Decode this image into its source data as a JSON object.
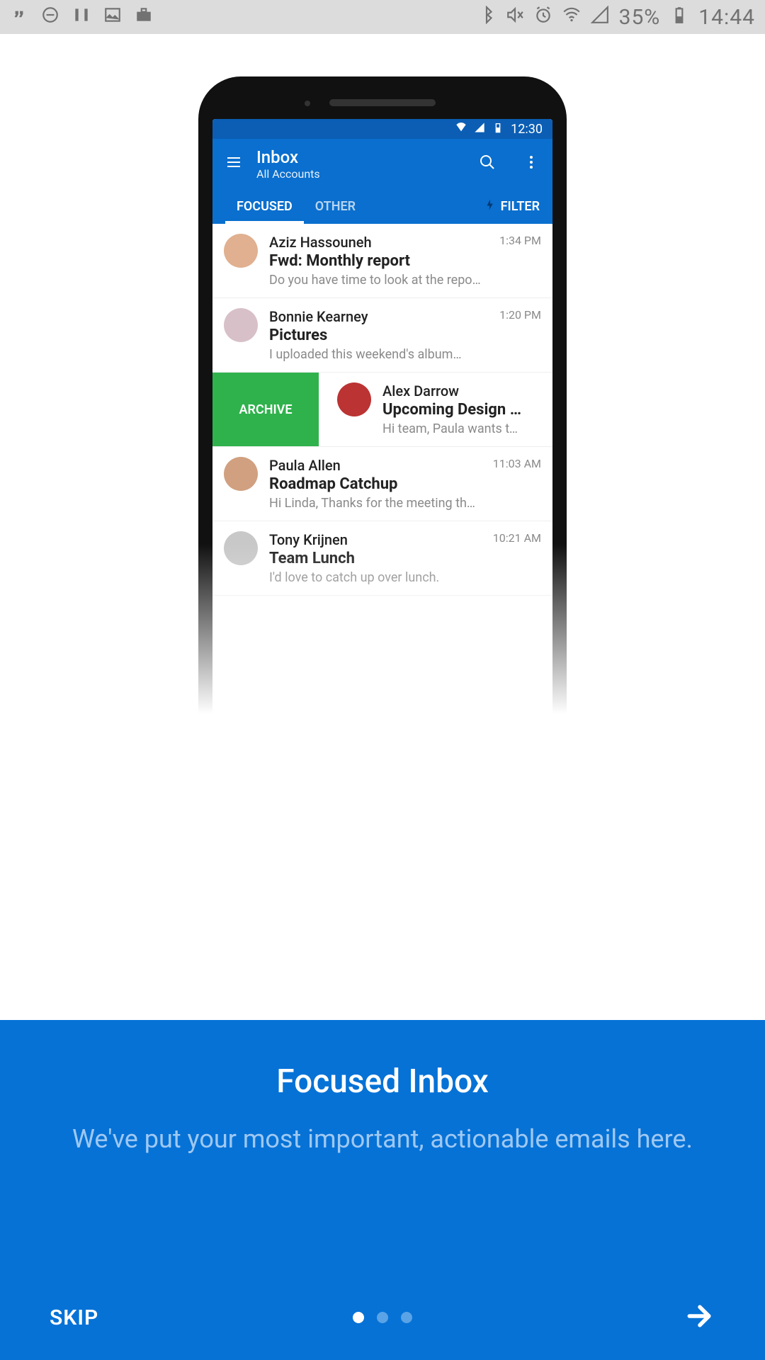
{
  "host_status": {
    "battery_pct": "35%",
    "clock": "14:44"
  },
  "mock": {
    "status_clock": "12:30",
    "appbar": {
      "title": "Inbox",
      "subtitle": "All Accounts"
    },
    "tabs": {
      "focused": "FOCUSED",
      "other": "OTHER",
      "filter": "FILTER"
    },
    "archive_label": "ARCHIVE",
    "messages": [
      {
        "sender": "Aziz Hassouneh",
        "subject": "Fwd: Monthly report",
        "preview": "Do you have time to look at the report…",
        "time": "1:34 PM"
      },
      {
        "sender": "Bonnie Kearney",
        "subject": "Pictures",
        "preview": "I uploaded this weekend's album…",
        "time": "1:20 PM"
      },
      {
        "sender": "Alex Darrow",
        "subject": "Upcoming Design Review",
        "preview": "Hi team, Paula wants to do",
        "time": ""
      },
      {
        "sender": "Paula Allen",
        "subject": "Roadmap Catchup",
        "preview": "Hi Linda, Thanks for the meeting this…",
        "time": "11:03 AM"
      },
      {
        "sender": "Tony Krijnen",
        "subject": "Team Lunch",
        "preview": "I'd love to catch up over lunch.",
        "time": "10:21 AM"
      }
    ]
  },
  "onboarding": {
    "title": "Focused Inbox",
    "subtitle": "We've put your most important, actionable emails here.",
    "skip": "SKIP"
  }
}
